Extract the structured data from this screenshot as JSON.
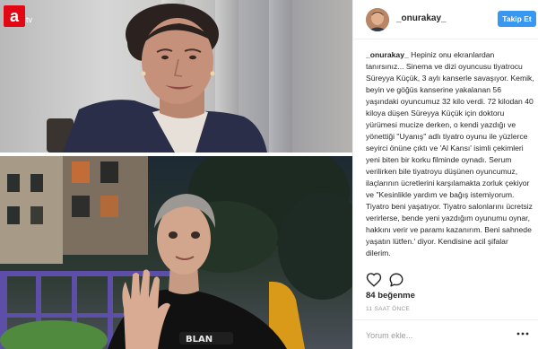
{
  "media": {
    "channel_logo_text": "a",
    "channel_logo_suffix": "tv",
    "badge_text": "BLAN",
    "colors": {
      "logo_red": "#e30613"
    }
  },
  "header": {
    "username": "_onurakay_",
    "follow_label": "Takip Et",
    "colors": {
      "follow_blue": "#3897f0"
    }
  },
  "caption": {
    "username": "_onurakay_",
    "text": " Hepiniz onu ekranlardan tanırsınız... Sinema ve dizi oyuncusu tiyatrocu Süreyya Küçük, 3 aylı kanserle savaşıyor. Kemik, beyin ve göğüs kanserine yakalanan 56 yaşındaki oyuncumuz 32 kilo verdi. 72 kilodan 40 kiloya düşen Süreyya Küçük için doktoru yürümesi mucize derken, o kendi yazdığı ve yönettiği \"Uyanış\" adlı tiyatro oyunu ile yüzlerce seyirci önüne çıktı ve 'Al Kansı' isimli çekimleri yeni biten bir korku filminde oynadı. Serum verilirken bile tiyatroyu düşünen oyuncumuz, ilaçlarının ücretlerini karşılamakta zorluk çekiyor ve \"Kesinlikle yardım ve bağış istemiyorum. Tiyatro beni yaşatıyor. Tiyatro salonlarını ücretsiz verirlerse, bende yeni yazdığım oyunumu oynar, hakkını verir ve paramı kazanırım. Beni sahnede yaşatın lütfen.' diyor. Kendisine acil şifalar dilerim."
  },
  "actions": {
    "like_icon": "heart-outline-icon",
    "comment_icon": "comment-bubble-icon"
  },
  "likes": "84 beğenme",
  "time": "11 SAAT ÖNCE",
  "comment": {
    "placeholder": "Yorum ekle...",
    "more_icon": "more-dots-icon"
  }
}
